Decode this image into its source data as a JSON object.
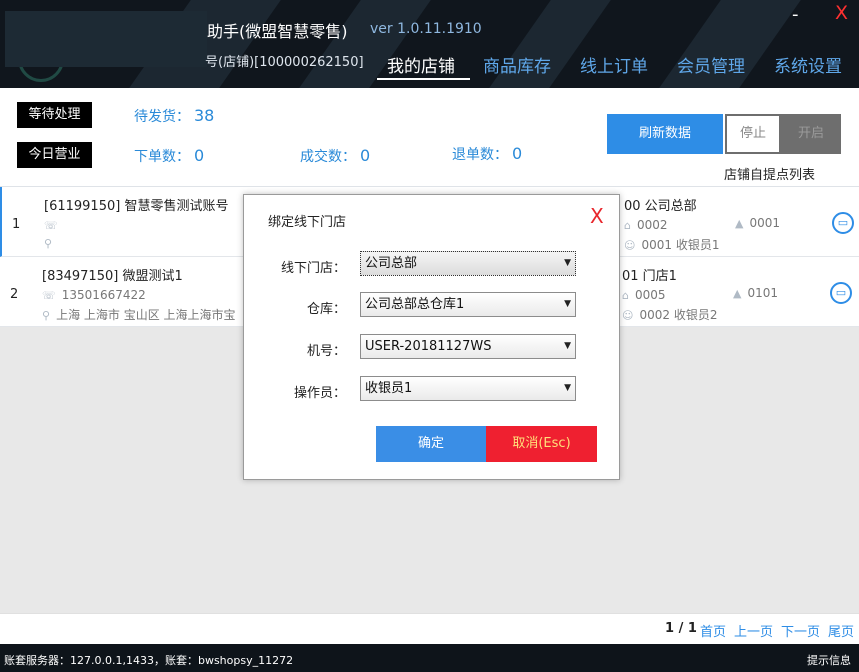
{
  "header": {
    "app_title": "助手(微盟智慧零售)",
    "version": "ver 1.0.11.1910",
    "account_line": "号(店铺)[100000262150]",
    "minimize": "-",
    "close": "X",
    "nav": [
      "我的店铺",
      "商品库存",
      "线上订单",
      "会员管理",
      "系统设置"
    ]
  },
  "status": {
    "pending_tag": "等待处理",
    "today_tag": "今日营业",
    "to_ship_label": "待发货：",
    "to_ship_value": "38",
    "orders_label": "下单数：",
    "orders_value": "0",
    "deals_label": "成交数：",
    "deals_value": "0",
    "refunds_label": "退单数：",
    "refunds_value": "0",
    "refresh_button": "刷新数据",
    "toggle_off": "停止",
    "toggle_on": "开启",
    "pickup_list_label": "店铺自提点列表"
  },
  "stores": [
    {
      "index": "1",
      "name": "[61199150] 智慧零售测试账号",
      "phone": "",
      "address": "",
      "right_store": "00 公司总部",
      "right_code": "0002",
      "right_cashier": "0001 收银员1",
      "right_no": "0001"
    },
    {
      "index": "2",
      "name": "[83497150] 微盟测试1",
      "phone": "13501667422",
      "address": "上海 上海市 宝山区 上海上海市宝",
      "right_store": "01 门店1",
      "right_code": "0005",
      "right_cashier": "0002 收银员2",
      "right_no": "0101"
    }
  ],
  "pager": {
    "count": "1 / 1",
    "first": "首页",
    "prev": "上一页",
    "next": "下一页",
    "last": "尾页"
  },
  "footer": {
    "server": "账套服务器：127.0.0.1,1433，账套：bwshopsy_11272",
    "hint": "提示信息"
  },
  "modal": {
    "title": "绑定线下门店",
    "close": "X",
    "store_label": "线下门店：",
    "store_value": "公司总部",
    "warehouse_label": "仓库：",
    "warehouse_value": "公司总部总仓库1",
    "machine_label": "机号：",
    "machine_value": "USER-20181127WS",
    "operator_label": "操作员：",
    "operator_value": "收银员1",
    "ok": "确定",
    "cancel": "取消(Esc)"
  },
  "colors": {
    "accent": "#2e8de6",
    "danger": "#ef2030",
    "header_bg": "#10161d"
  }
}
